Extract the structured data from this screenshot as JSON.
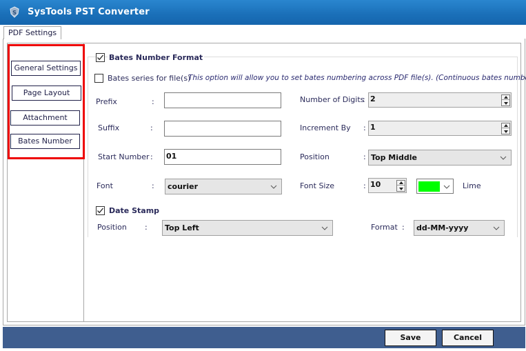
{
  "window": {
    "title": "SysTools PST Converter",
    "logo_icon": "systools-shield-icon"
  },
  "tabs": [
    {
      "label": "PDF Settings",
      "active": true
    }
  ],
  "sidebar": {
    "items": [
      {
        "label": "General Settings"
      },
      {
        "label": "Page Layout"
      },
      {
        "label": "Attachment"
      },
      {
        "label": "Bates Number"
      }
    ],
    "highlight_color": "#ee0000"
  },
  "bates": {
    "enabled_label": "Bates Number Format",
    "enabled": true,
    "series_label": "Bates series for file(s)",
    "series_checked": false,
    "series_hint": "This option will allow you to set bates numbering across PDF file(s).  (Continuous bates numbering)",
    "prefix": {
      "label": "Prefix",
      "colon": ":",
      "value": ""
    },
    "suffix": {
      "label": "Suffix",
      "colon": ":",
      "value": ""
    },
    "start_number": {
      "label": "Start Number",
      "colon": ":",
      "value": "01"
    },
    "number_of_digits": {
      "label": "Number of Digits",
      "colon": ":",
      "value": "2"
    },
    "increment_by": {
      "label": "Increment By",
      "colon": ":",
      "value": "1"
    },
    "position": {
      "label": "Position",
      "colon": ":",
      "value": "Top Middle"
    },
    "font": {
      "label": "Font",
      "colon": ":",
      "value": "courier"
    },
    "font_size": {
      "label": "Font Size",
      "colon": ":",
      "value": "10"
    },
    "font_color": {
      "name": "Lime",
      "hex": "#00ff00"
    }
  },
  "date_stamp": {
    "label": "Date Stamp",
    "checked": true,
    "position": {
      "label": "Position",
      "colon": ":",
      "value": "Top Left"
    },
    "format": {
      "label": "Format",
      "colon": ":",
      "value": "dd-MM-yyyy"
    }
  },
  "footer": {
    "save_label": "Save",
    "cancel_label": "Cancel"
  }
}
